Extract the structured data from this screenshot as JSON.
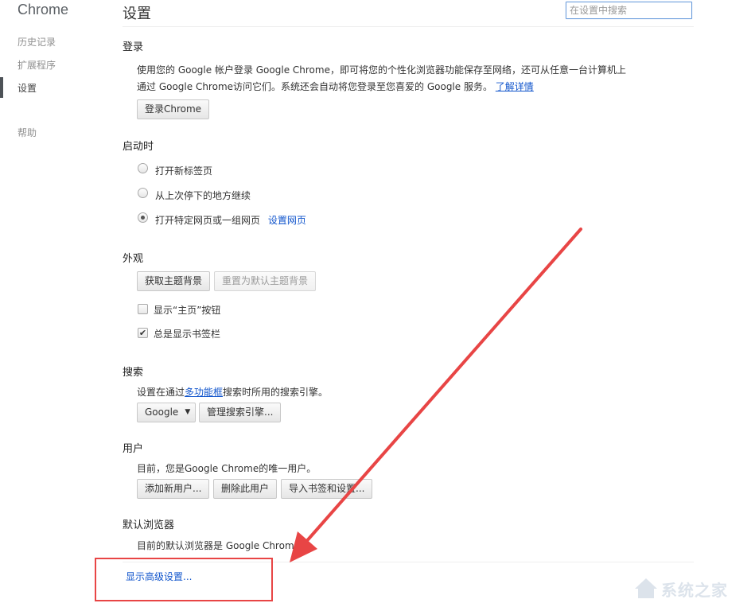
{
  "sidebar": {
    "brand": "Chrome",
    "items": [
      {
        "label": "历史记录"
      },
      {
        "label": "扩展程序"
      },
      {
        "label": "设置",
        "active": true
      },
      {
        "label": "帮助"
      }
    ]
  },
  "header": {
    "title": "设置",
    "search_placeholder": "在设置中搜索"
  },
  "signin": {
    "title": "登录",
    "desc_line1": "使用您的 Google 帐户登录 Google Chrome，即可将您的个性化浏览器功能保存至网络，还可从任意一台计算机上",
    "desc_line2": "通过 Google Chrome访问它们。系统还会自动将您登录至您喜爱的 Google 服务。",
    "learn_more": "了解详情",
    "button": "登录Chrome"
  },
  "startup": {
    "title": "启动时",
    "options": [
      {
        "label": "打开新标签页",
        "checked": false
      },
      {
        "label": "从上次停下的地方继续",
        "checked": false
      },
      {
        "label": "打开特定网页或一组网页",
        "checked": true
      }
    ],
    "set_pages_link": "设置网页"
  },
  "appearance": {
    "title": "外观",
    "get_themes": "获取主题背景",
    "reset_theme": "重置为默认主题背景",
    "show_home": {
      "label": "显示“主页”按钮",
      "checked": false
    },
    "show_bookmarks": {
      "label": "总是显示书签栏",
      "checked": true
    }
  },
  "search": {
    "title": "搜索",
    "desc_prefix": "设置在通过",
    "omnibox_link": "多功能框",
    "desc_suffix": "搜索时所用的搜索引擎。",
    "engine_selected": "Google",
    "manage_button": "管理搜索引擎..."
  },
  "users": {
    "title": "用户",
    "desc": "目前，您是Google Chrome的唯一用户。",
    "add_user": "添加新用户...",
    "delete_user": "删除此用户",
    "import": "导入书签和设置..."
  },
  "default_browser": {
    "title": "默认浏览器",
    "desc": "目前的默认浏览器是 Google Chrome。"
  },
  "advanced_link": "显示高级设置...",
  "watermark": "系统之家",
  "colors": {
    "accent_link": "#1155cc",
    "annotation_red": "#e84545"
  },
  "icons": {
    "arrow": "red-annotation-arrow-icon",
    "checkmark": "checkmark-icon",
    "dropdown": "triangle-down-icon"
  }
}
